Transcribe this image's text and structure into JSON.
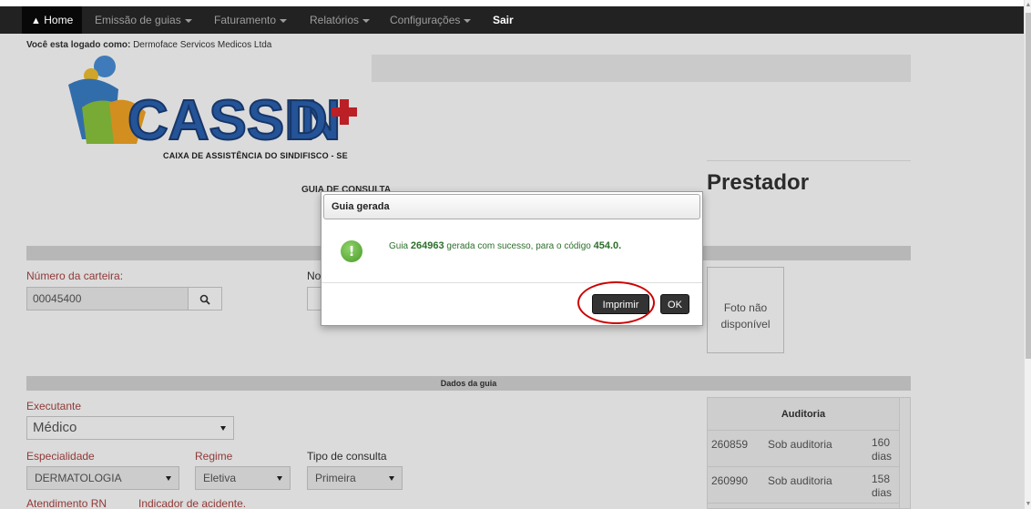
{
  "nav": {
    "home": "Home",
    "emissao": "Emissão de guias",
    "faturamento": "Faturamento",
    "relatorios": "Relatórios",
    "configuracoes": "Configurações",
    "sair": "Sair"
  },
  "logged": {
    "prefix": "Você esta logado como:",
    "user": "Dermoface Servicos Medicos Ltda"
  },
  "logo": {
    "name": "CASSIND",
    "subtitle": "CAIXA DE ASSISTÊNCIA DO SINDIFISCO - SE"
  },
  "header": {
    "guia_title": "GUIA DE CONSULTA",
    "prestador": "Prestador"
  },
  "form": {
    "numero_carteira_label": "Número da carteira:",
    "numero_carteira_value": "00045400",
    "nome_label_partial": "No",
    "foto_text": "Foto não disponível"
  },
  "dialog": {
    "title": "Guia gerada",
    "msg_prefix": "Guia",
    "guia_number": "264963",
    "msg_middle": "gerada com sucesso, para o código",
    "codigo": "454.0",
    "msg_end": ".",
    "imprimir": "Imprimir",
    "ok": "OK"
  },
  "dados": {
    "section_title": "Dados da guia",
    "executante_label": "Executante",
    "executante_value": "Médico",
    "especialidade_label": "Especialidade",
    "especialidade_value": "DERMATOLOGIA",
    "regime_label": "Regime",
    "regime_value": "Eletiva",
    "tipo_label": "Tipo de consulta",
    "tipo_value": "Primeira",
    "atendimento_label": "Atendimento RN",
    "indicador_label": "Indicador de acidente."
  },
  "auditoria": {
    "title": "Auditoria",
    "rows": [
      {
        "guia": "260859",
        "status": "Sob auditoria",
        "dias_num": "160",
        "dias_unit": "dias"
      },
      {
        "guia": "260990",
        "status": "Sob auditoria",
        "dias_num": "158",
        "dias_unit": "dias"
      }
    ]
  }
}
